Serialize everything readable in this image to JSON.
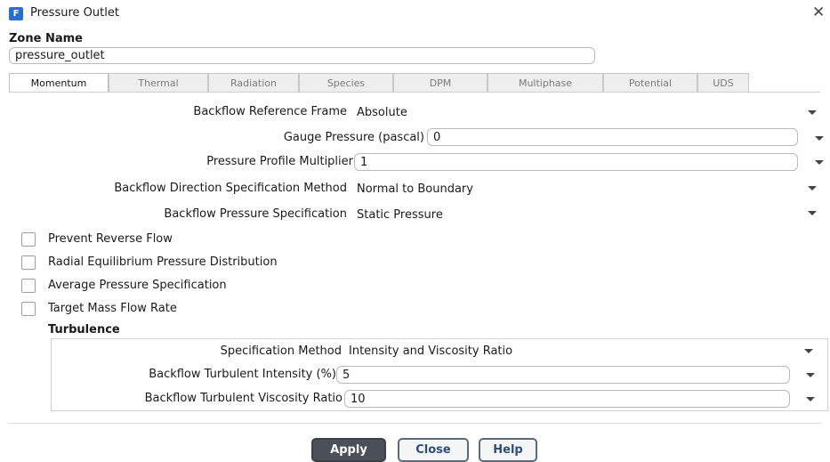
{
  "window": {
    "title": "Pressure Outlet",
    "close_glyph": "✕"
  },
  "zone": {
    "label": "Zone Name",
    "value": "pressure_outlet"
  },
  "tabs": [
    {
      "label": "Momentum",
      "active": true
    },
    {
      "label": "Thermal",
      "active": false
    },
    {
      "label": "Radiation",
      "active": false
    },
    {
      "label": "Species",
      "active": false
    },
    {
      "label": "DPM",
      "active": false
    },
    {
      "label": "Multiphase",
      "active": false
    },
    {
      "label": "Potential",
      "active": false
    },
    {
      "label": "UDS",
      "active": false
    }
  ],
  "momentum": {
    "backflow_reference_frame": {
      "label": "Backflow Reference Frame",
      "value": "Absolute"
    },
    "gauge_pressure": {
      "label": "Gauge Pressure (pascal)",
      "value": "0"
    },
    "pressure_profile_multiplier": {
      "label": "Pressure Profile Multiplier",
      "value": "1"
    },
    "backflow_direction_method": {
      "label": "Backflow Direction Specification Method",
      "value": "Normal to Boundary"
    },
    "backflow_pressure_spec": {
      "label": "Backflow Pressure Specification",
      "value": "Static Pressure"
    },
    "checkboxes": {
      "prevent_reverse_flow": {
        "label": "Prevent Reverse Flow",
        "checked": false
      },
      "radial_equilibrium": {
        "label": "Radial Equilibrium Pressure Distribution",
        "checked": false
      },
      "average_pressure": {
        "label": "Average Pressure Specification",
        "checked": false
      },
      "target_mass_flow": {
        "label": "Target Mass Flow Rate",
        "checked": false
      }
    }
  },
  "turbulence": {
    "heading": "Turbulence",
    "spec_method": {
      "label": "Specification Method",
      "value": "Intensity and Viscosity Ratio"
    },
    "turbulent_intensity": {
      "label": "Backflow Turbulent Intensity (%)",
      "value": "5"
    },
    "viscosity_ratio": {
      "label": "Backflow Turbulent Viscosity Ratio",
      "value": "10"
    }
  },
  "buttons": {
    "apply": "Apply",
    "close": "Close",
    "help": "Help"
  }
}
